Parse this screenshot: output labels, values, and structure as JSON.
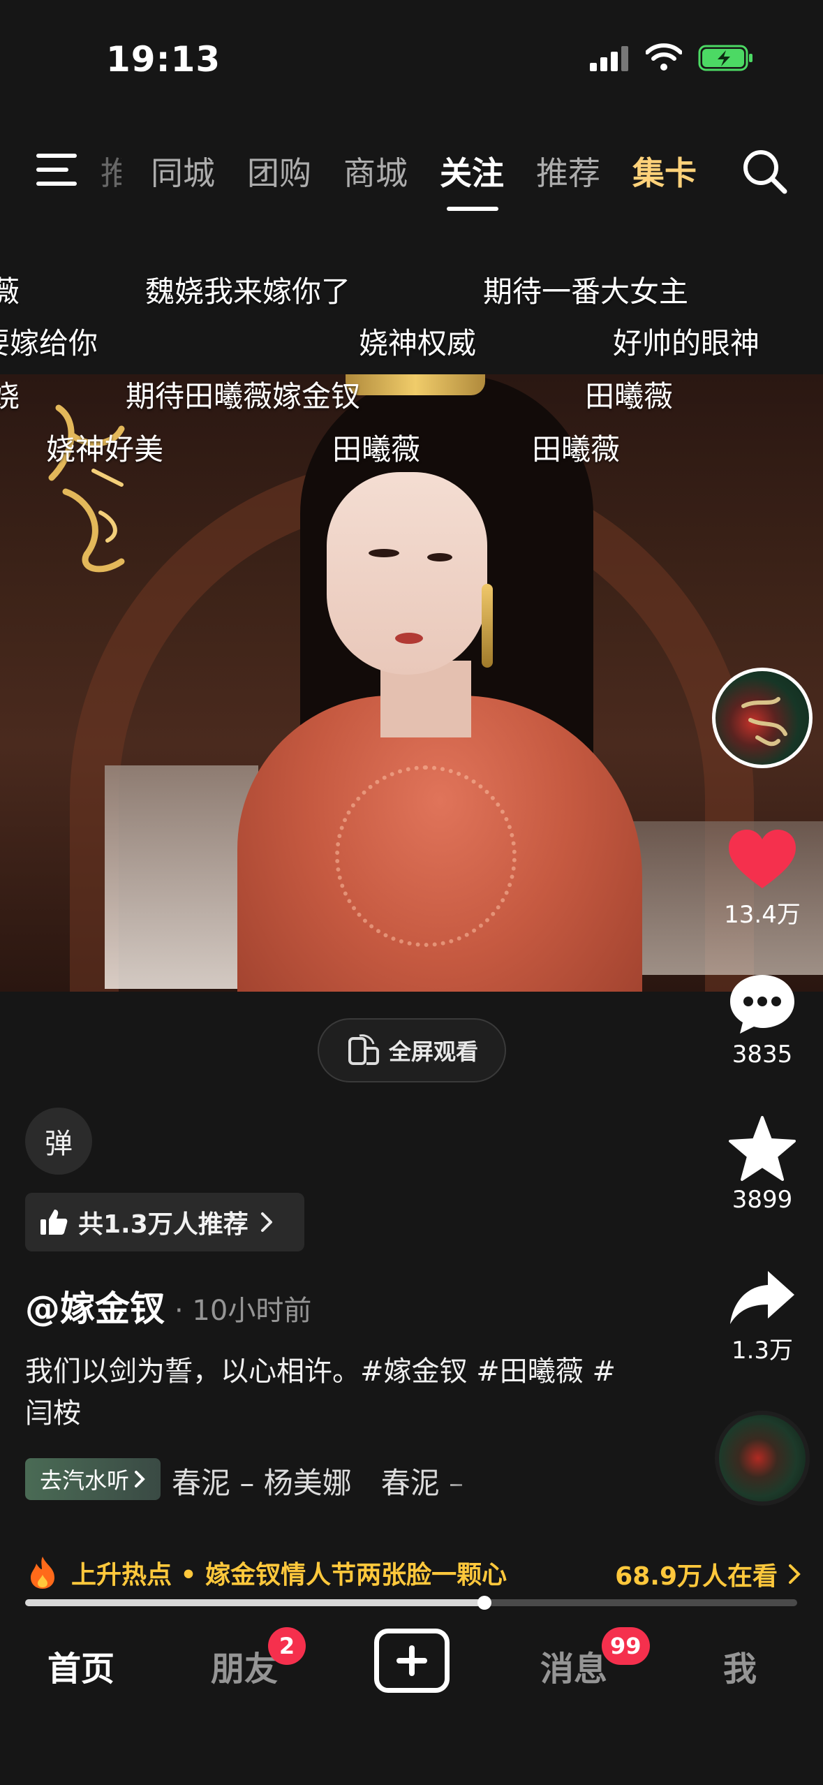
{
  "status_bar": {
    "time": "19:13"
  },
  "top_nav": {
    "tabs": [
      {
        "label": "推",
        "partial": true
      },
      {
        "label": "同城"
      },
      {
        "label": "团购"
      },
      {
        "label": "商城"
      },
      {
        "label": "关注",
        "active": true
      },
      {
        "label": "推荐"
      },
      {
        "label": "集卡",
        "highlight": true
      }
    ],
    "icons": [
      "menu-icon",
      "search-icon"
    ]
  },
  "danmaku": [
    "薇",
    "魏娆我来嫁你了",
    "期待一番大女主",
    "要嫁给你",
    "娆神权威",
    "好帅的眼神",
    "娆",
    "期待田曦薇嫁金钗",
    "田曦薇",
    "娆神好美",
    "田曦薇",
    "田曦薇"
  ],
  "player": {
    "fullscreen_label": "全屏观看",
    "danmaku_toggle": "弹",
    "progress": 0.595
  },
  "post": {
    "recommend_text": "共1.3万人推荐",
    "author": "@嫁金钗",
    "time": "· 10小时前",
    "caption": "我们以剑为誓，以心相许。#嫁金钗 #田曦薇 #闫桉",
    "music_badge": "去汽水听",
    "music_title": "春泥 – 杨美娜　春泥 –"
  },
  "actions": {
    "likes": "13.4万",
    "comments": "3835",
    "favorites": "3899",
    "shares": "1.3万"
  },
  "hot": {
    "text": "上升热点 • 嫁金钗情人节两张脸一颗心",
    "watching": "68.9万人在看"
  },
  "bottom_tabs": {
    "home": "首页",
    "friends": "朋友",
    "friends_badge": "2",
    "messages": "消息",
    "messages_badge": "99",
    "me": "我"
  },
  "colors": {
    "accent_like": "#f5304d",
    "hot": "#ffc83c",
    "card_tab": "#ffd27a"
  }
}
